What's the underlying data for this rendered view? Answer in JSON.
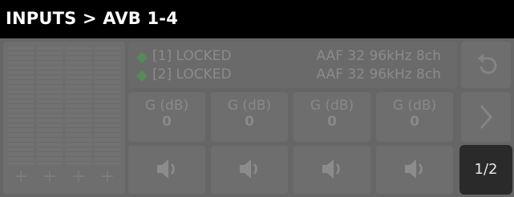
{
  "header": {
    "title": "INPUTS > AVB 1-4"
  },
  "meters": {
    "channels": [
      {
        "add_label": "+"
      },
      {
        "add_label": "+"
      },
      {
        "add_label": "+"
      },
      {
        "add_label": "+"
      }
    ]
  },
  "streams": [
    {
      "label": "[1] LOCKED",
      "format": "AAF 32 96kHz 8ch",
      "status_color": "#588a58"
    },
    {
      "label": "[2] LOCKED",
      "format": "AAF 32 96kHz 8ch",
      "status_color": "#588a58"
    }
  ],
  "gains": [
    {
      "label": "G (dB)",
      "value": "0"
    },
    {
      "label": "G (dB)",
      "value": "0"
    },
    {
      "label": "G (dB)",
      "value": "0"
    },
    {
      "label": "G (dB)",
      "value": "0"
    }
  ],
  "pagination": {
    "label": "1/2"
  },
  "icons": {
    "back": "undo-arrow-icon",
    "next": "chevron-right-icon",
    "volume": "speaker-icon"
  }
}
